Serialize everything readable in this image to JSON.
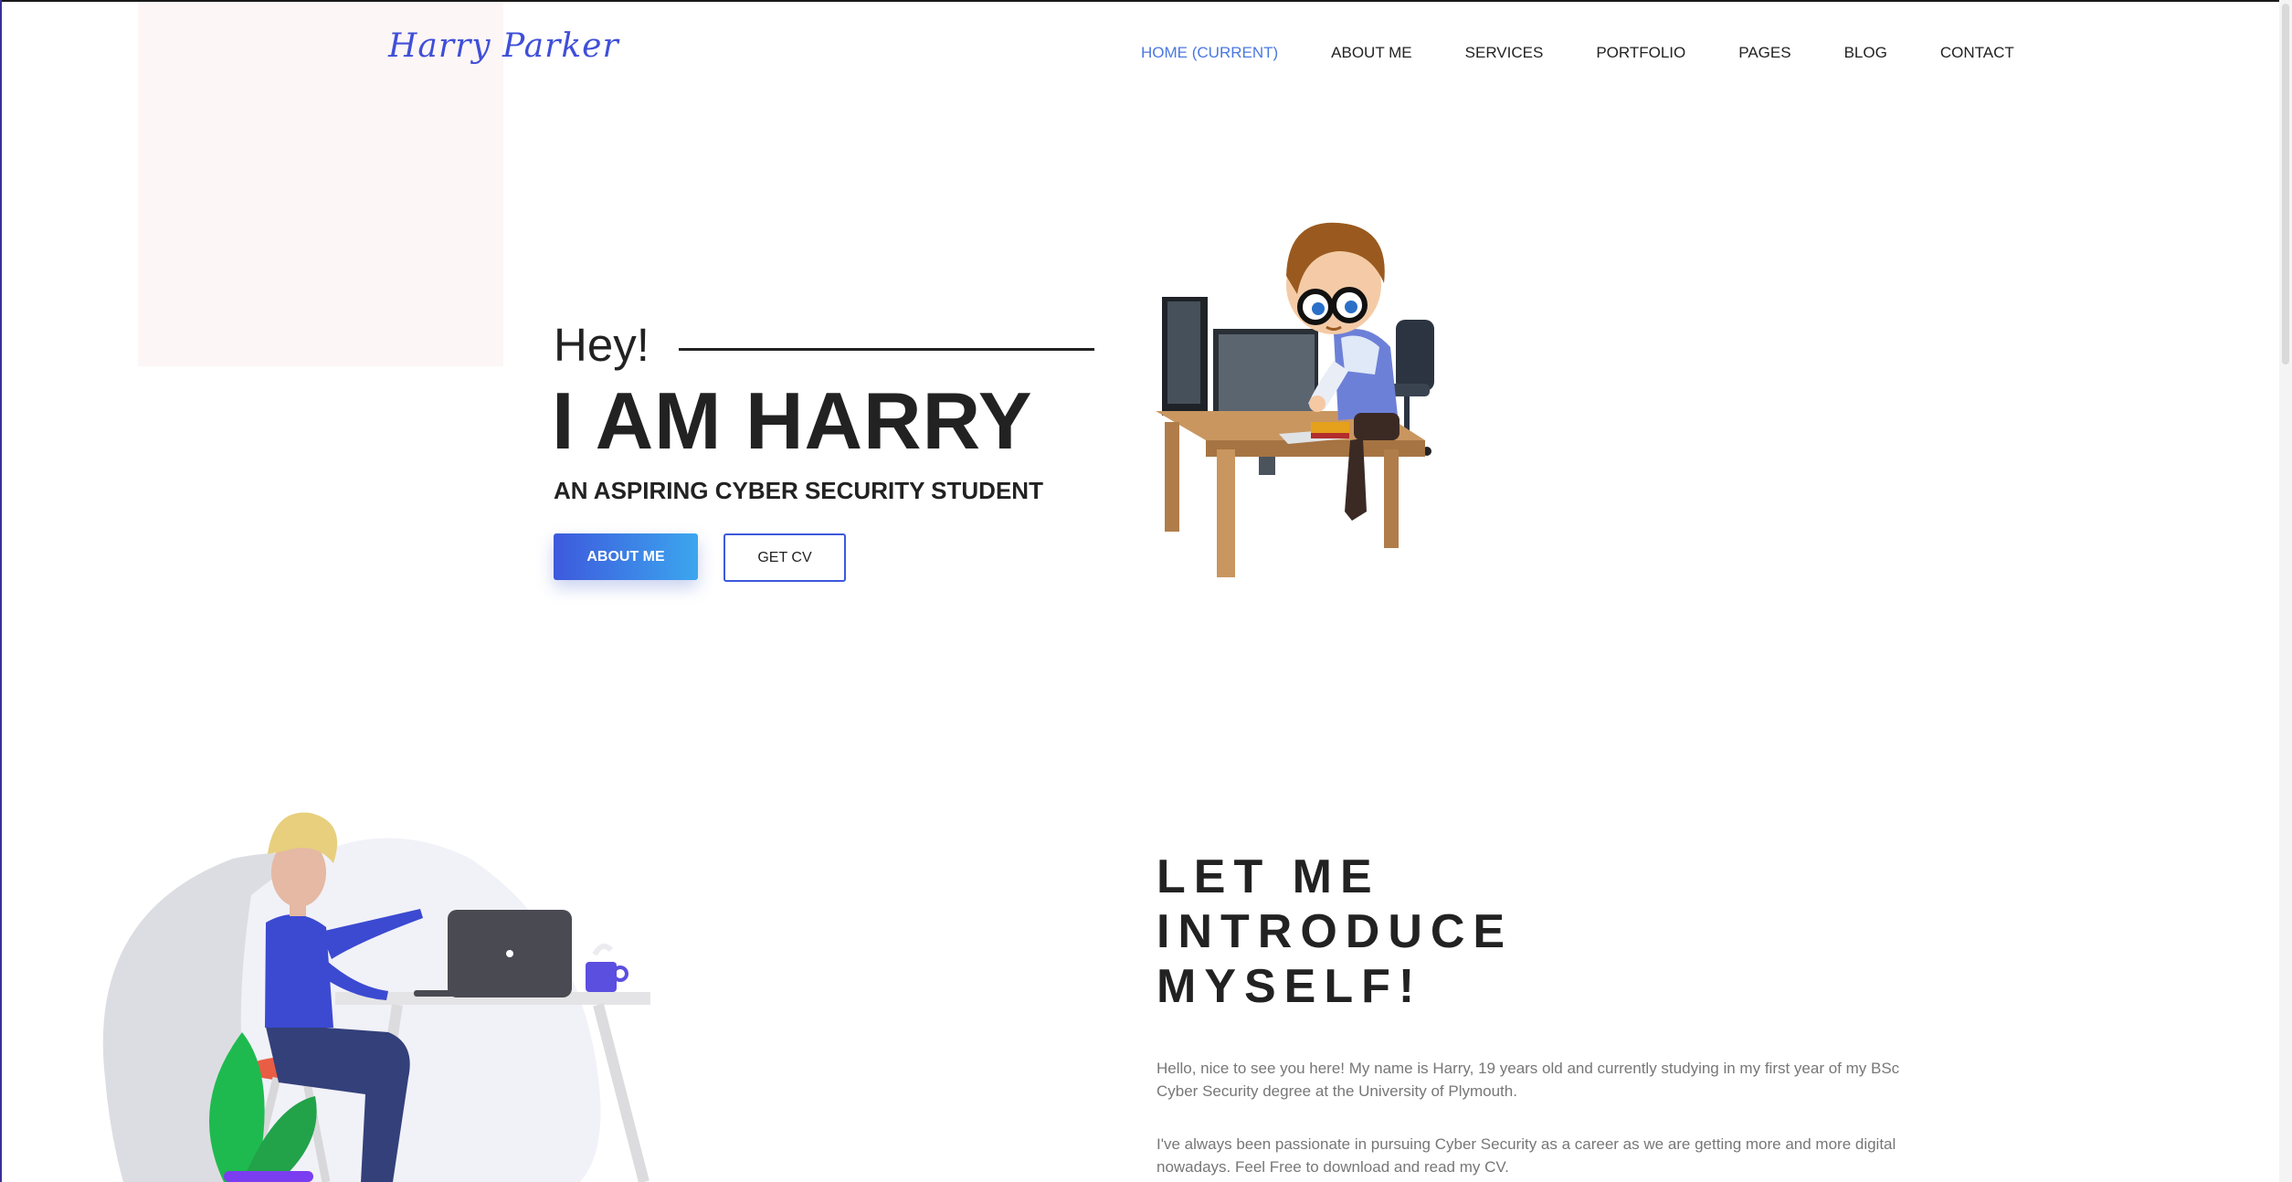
{
  "brand": {
    "logo_text": "Harry Parker",
    "accent_color": "#3f4fd8"
  },
  "nav": {
    "items": [
      {
        "label": "HOME (CURRENT)",
        "active": true
      },
      {
        "label": "ABOUT ME",
        "active": false
      },
      {
        "label": "SERVICES",
        "active": false
      },
      {
        "label": "PORTFOLIO",
        "active": false
      },
      {
        "label": "PAGES",
        "active": false
      },
      {
        "label": "BLOG",
        "active": false
      },
      {
        "label": "CONTACT",
        "active": false
      }
    ]
  },
  "hero": {
    "greeting": "Hey!",
    "name": "I AM HARRY",
    "tagline": "AN ASPIRING CYBER SECURITY STUDENT",
    "primary_button": "ABOUT ME",
    "secondary_button": "GET CV",
    "illustration_icon": "developer-at-desk-illustration"
  },
  "intro": {
    "title_lines": [
      "LET ME",
      "INTRODUCE",
      "MYSELF!"
    ],
    "paragraphs": [
      "Hello, nice to see you here! My name is Harry, 19 years old and currently studying in my first year of my BSc Cyber Security degree at the University of Plymouth.",
      "I've always been passionate in pursuing Cyber Security as a career as we are getting more and more digital nowadays. Feel Free to download and read my CV."
    ],
    "illustration_icon": "person-with-laptop-illustration"
  },
  "colors": {
    "gradient_start": "#3d59dd",
    "gradient_end": "#3ca6ee",
    "nav_active": "#4a78e0"
  }
}
